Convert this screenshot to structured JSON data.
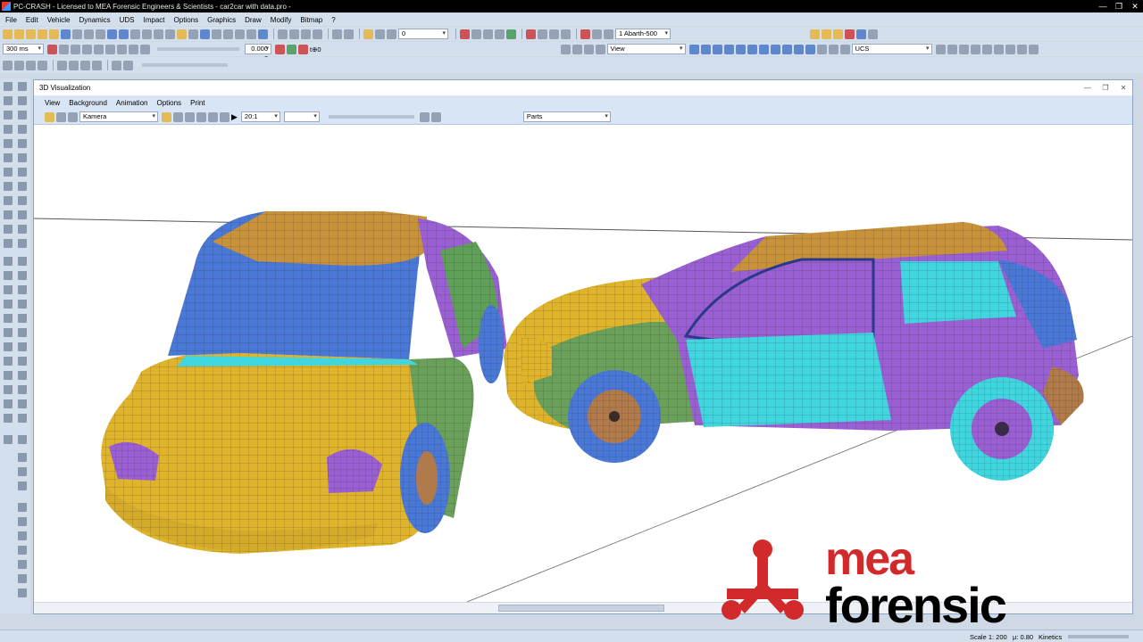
{
  "window": {
    "title": "PC-CRASH - Licensed to MEA Forensic Engineers & Scientists - car2car with data.pro -",
    "min": "—",
    "max": "❐",
    "close": "✕"
  },
  "menu": [
    "File",
    "Edit",
    "Vehicle",
    "Dynamics",
    "UDS",
    "Impact",
    "Options",
    "Graphics",
    "Draw",
    "Modify",
    "Bitmap",
    "?"
  ],
  "toolbar": {
    "layer_value": "0",
    "vehicle_select": "1  Abarth-500",
    "time_step": "300 ms",
    "time_value": "0.000 s",
    "time_suffix": "t⊕0",
    "view_select": "View",
    "ucs_select": "UCS"
  },
  "viz": {
    "title": "3D Visualization",
    "menu": [
      "View",
      "Background",
      "Animation",
      "Options",
      "Print"
    ],
    "camera_select": "Kamera",
    "speed_select": "20:1",
    "parts_select": "Parts"
  },
  "status": {
    "scale": "Scale 1: 200",
    "mu": "µ: 0.80",
    "mode": "Kinetics"
  },
  "logo": {
    "line1": "mea",
    "line2": "forensic",
    "color_red": "#d22a2a",
    "color_black": "#000000"
  },
  "colors": {
    "yellow": "#e0b42a",
    "blue": "#4a78d6",
    "purple": "#9b5fd4",
    "green": "#6aa05a",
    "cyan": "#3fd6e0",
    "brown": "#b07a4a",
    "orange": "#c8923a"
  }
}
